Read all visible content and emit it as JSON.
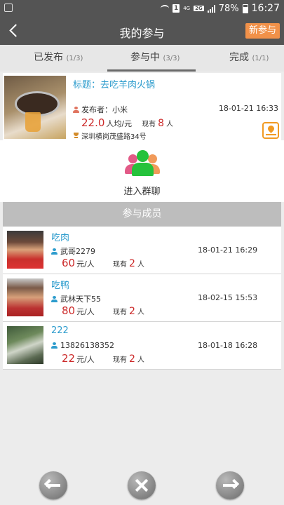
{
  "status_bar": {
    "network": "4G",
    "network_small": "2G",
    "sim_badge": "1",
    "battery_percent": "78%",
    "time": "16:27"
  },
  "header": {
    "title": "我的参与",
    "new_button": "新参与"
  },
  "tabs": [
    {
      "label": "已发布",
      "count": "(1/3)",
      "active": false
    },
    {
      "label": "参与中",
      "count": "(3/3)",
      "active": true
    },
    {
      "label": "完成",
      "count": "(1/1)",
      "active": false
    }
  ],
  "event": {
    "title": "标题：去吃羊肉火锅",
    "publisher_label": "发布者：小米",
    "date": "18-01-21 16:33",
    "price": "22.0",
    "price_unit": "人均/元",
    "now_label": "现有",
    "now_count": "8",
    "now_unit": "人",
    "address": "深圳横岗茂盛路34号"
  },
  "group_chat": {
    "label": "进入群聊"
  },
  "members_section": {
    "title": "参与成员"
  },
  "members": [
    {
      "name": "吃肉",
      "user": "武哥2279",
      "date": "18-01-21 16:29",
      "price": "60",
      "price_unit": "元/人",
      "now_label": "现有",
      "now_count": "2",
      "now_unit": "人"
    },
    {
      "name": "吃鸭",
      "user": "武林天下55",
      "date": "18-02-15 15:53",
      "price": "80",
      "price_unit": "元/人",
      "now_label": "现有",
      "now_count": "2",
      "now_unit": "人"
    },
    {
      "name": "222",
      "user": "13826138352",
      "date": "18-01-18 16:28",
      "price": "22",
      "price_unit": "元/人",
      "now_label": "现有",
      "now_count": "2",
      "now_unit": "人"
    }
  ],
  "icons": {
    "back": "chevron-left-icon",
    "publisher": "person-icon",
    "address": "trophy-icon",
    "map": "map-pin-icon",
    "group": "group-people-icon",
    "prev": "arrow-left-icon",
    "close": "close-icon",
    "next": "arrow-right-icon"
  },
  "colors": {
    "header_bg": "#545454",
    "accent_orange": "#f19149",
    "link_blue": "#2d9ccd",
    "price_red": "#cc2a2a",
    "group_green": "#25c23b",
    "group_pink": "#e25a87",
    "group_orange": "#f19a5a"
  }
}
